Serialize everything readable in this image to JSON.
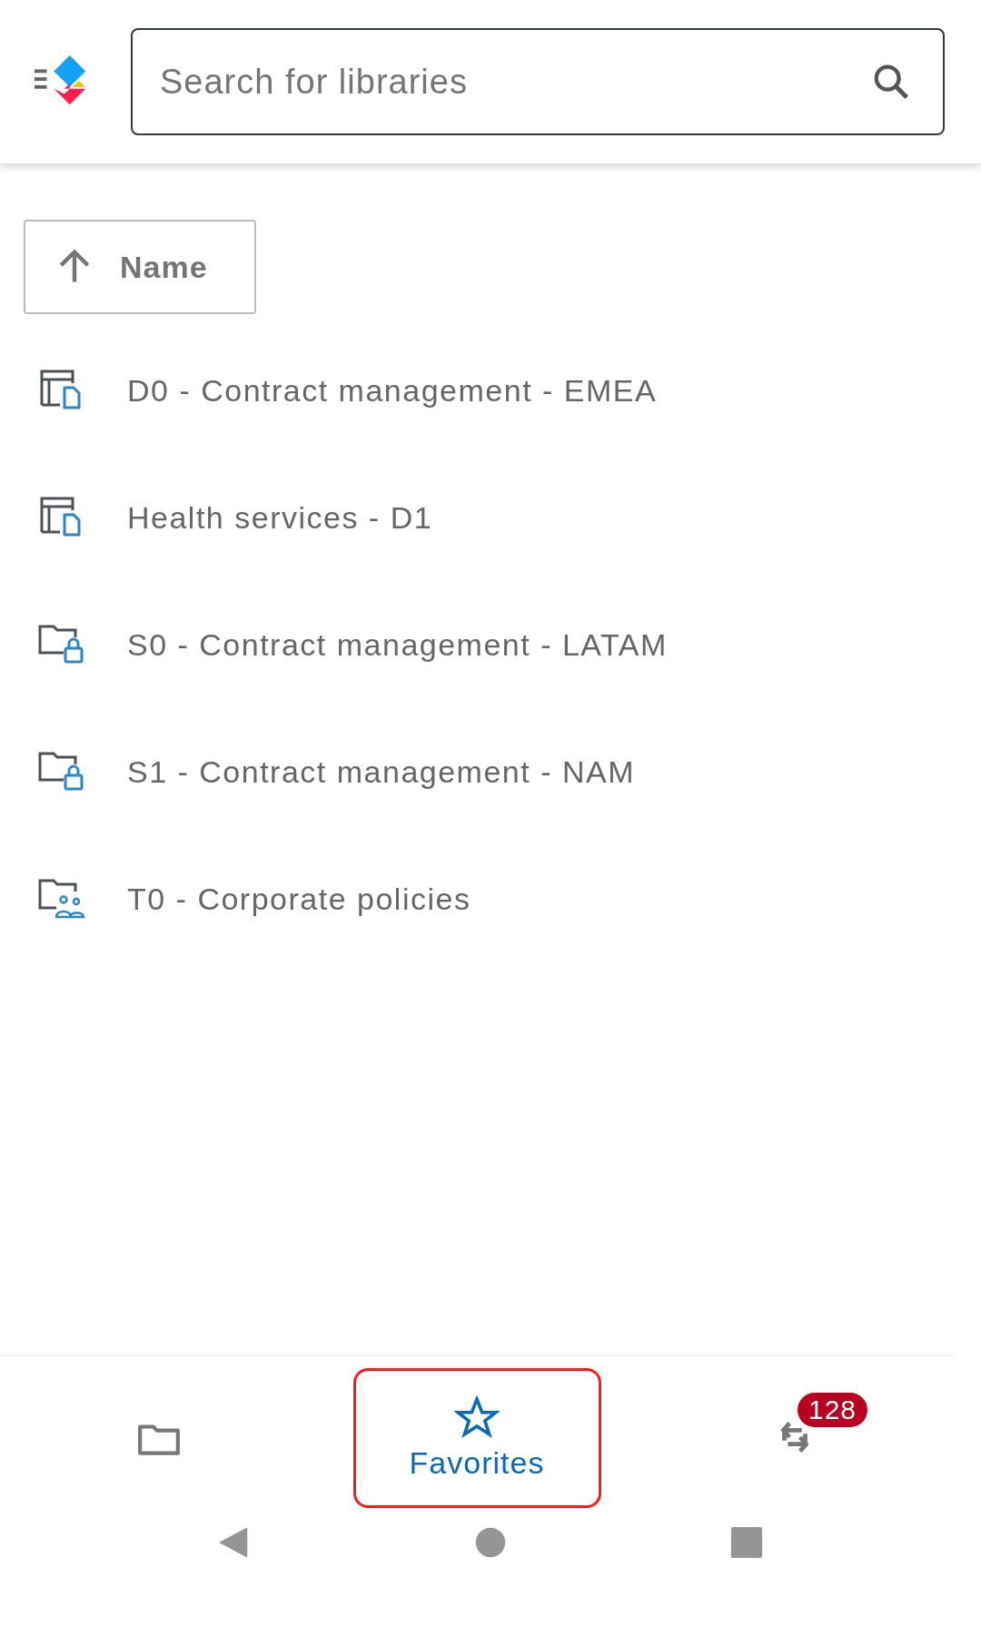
{
  "search": {
    "placeholder": "Search for libraries"
  },
  "sort": {
    "label": "Name"
  },
  "libraries": [
    {
      "name": "D0 - Contract management - EMEA",
      "kind": "drive"
    },
    {
      "name": "Health services - D1",
      "kind": "drive"
    },
    {
      "name": "S0 - Contract management - LATAM",
      "kind": "locked"
    },
    {
      "name": "S1 - Contract management - NAM",
      "kind": "locked"
    },
    {
      "name": "T0 - Corporate policies",
      "kind": "shared"
    }
  ],
  "bottom_nav": [
    {
      "kind": "folder",
      "selected": false
    },
    {
      "kind": "star",
      "label": "Favorites",
      "selected": true
    },
    {
      "kind": "sync",
      "badge": "128",
      "selected": false
    }
  ]
}
